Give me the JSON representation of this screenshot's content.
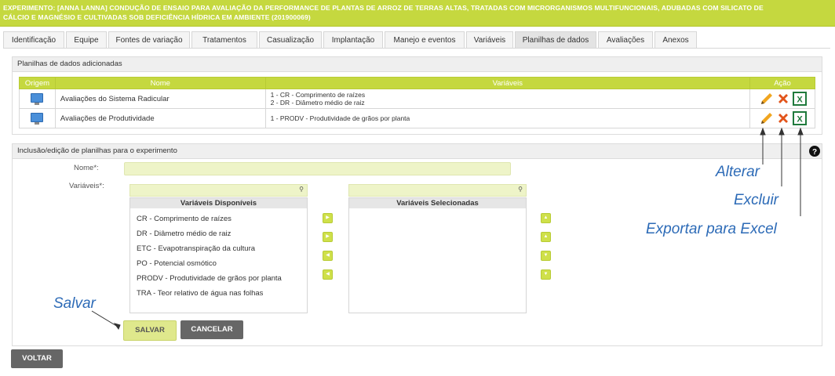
{
  "header": {
    "line1": "EXPERIMENTO: [ANNA LANNA] CONDUÇÃO DE ENSAIO PARA AVALIAÇÃO DA PERFORMANCE DE PLANTAS DE ARROZ DE TERRAS ALTAS, TRATADAS COM MICRORGANISMOS MULTIFUNCIONAIS, ADUBADAS COM SILICATO DE",
    "line2": "CÁLCIO E MAGNÉSIO E CULTIVADAS SOB DEFICIÊNCIA HÍDRICA EM AMBIENTE (201900069)",
    "bg_color": "#c5d83f"
  },
  "tabs": [
    "Identificação",
    "Equipe",
    "Fontes de variação",
    "Tratamentos",
    "Casualização",
    "Implantação",
    "Manejo e eventos",
    "Variáveis",
    "Planilhas de dados",
    "Avaliações",
    "Anexos"
  ],
  "active_tab": "Planilhas de dados",
  "sheets_panel": {
    "title": "Planilhas de dados adicionadas",
    "columns": {
      "origem": "Origem",
      "nome": "Nome",
      "variaveis": "Variáveis",
      "acao": "Ação"
    },
    "rows": [
      {
        "icon": "computer-icon",
        "nome": "Avaliações do Sistema Radicular",
        "variaveis": [
          "1 - CR - Comprimento de raízes",
          "2 - DR - Diâmetro médio de raiz"
        ]
      },
      {
        "icon": "computer-icon",
        "nome": "Avaliações de Produtividade",
        "variaveis": [
          "1 - PRODV - Produtividade de grãos por planta"
        ]
      }
    ]
  },
  "edit_panel": {
    "title": "Inclusão/edição de planilhas para o experimento",
    "nome_label": "Nome*:",
    "nome_value": "",
    "variaveis_label": "Variáveis*:",
    "available": {
      "title": "Variáveis Disponíveis",
      "items": [
        "CR - Comprimento de raízes",
        "DR - Diâmetro médio de raiz",
        "ETC - Evapotranspiração da cultura",
        "PO - Potencial osmótico",
        "PRODV - Produtividade de grãos por planta",
        "TRA - Teor relativo de água nas folhas"
      ]
    },
    "selected": {
      "title": "Variáveis Selecionadas",
      "items": []
    },
    "save_label": "SALVAR",
    "cancel_label": "CANCELAR"
  },
  "back_label": "VOLTAR",
  "annotations": {
    "alterar": "Alterar",
    "excluir": "Excluir",
    "exportar": "Exportar para Excel",
    "salvar": "Salvar"
  },
  "colors": {
    "accent": "#c5d83f",
    "annotation": "#2d6bb7",
    "cancel_bg": "#666666",
    "save_bg": "#dfe88c"
  }
}
